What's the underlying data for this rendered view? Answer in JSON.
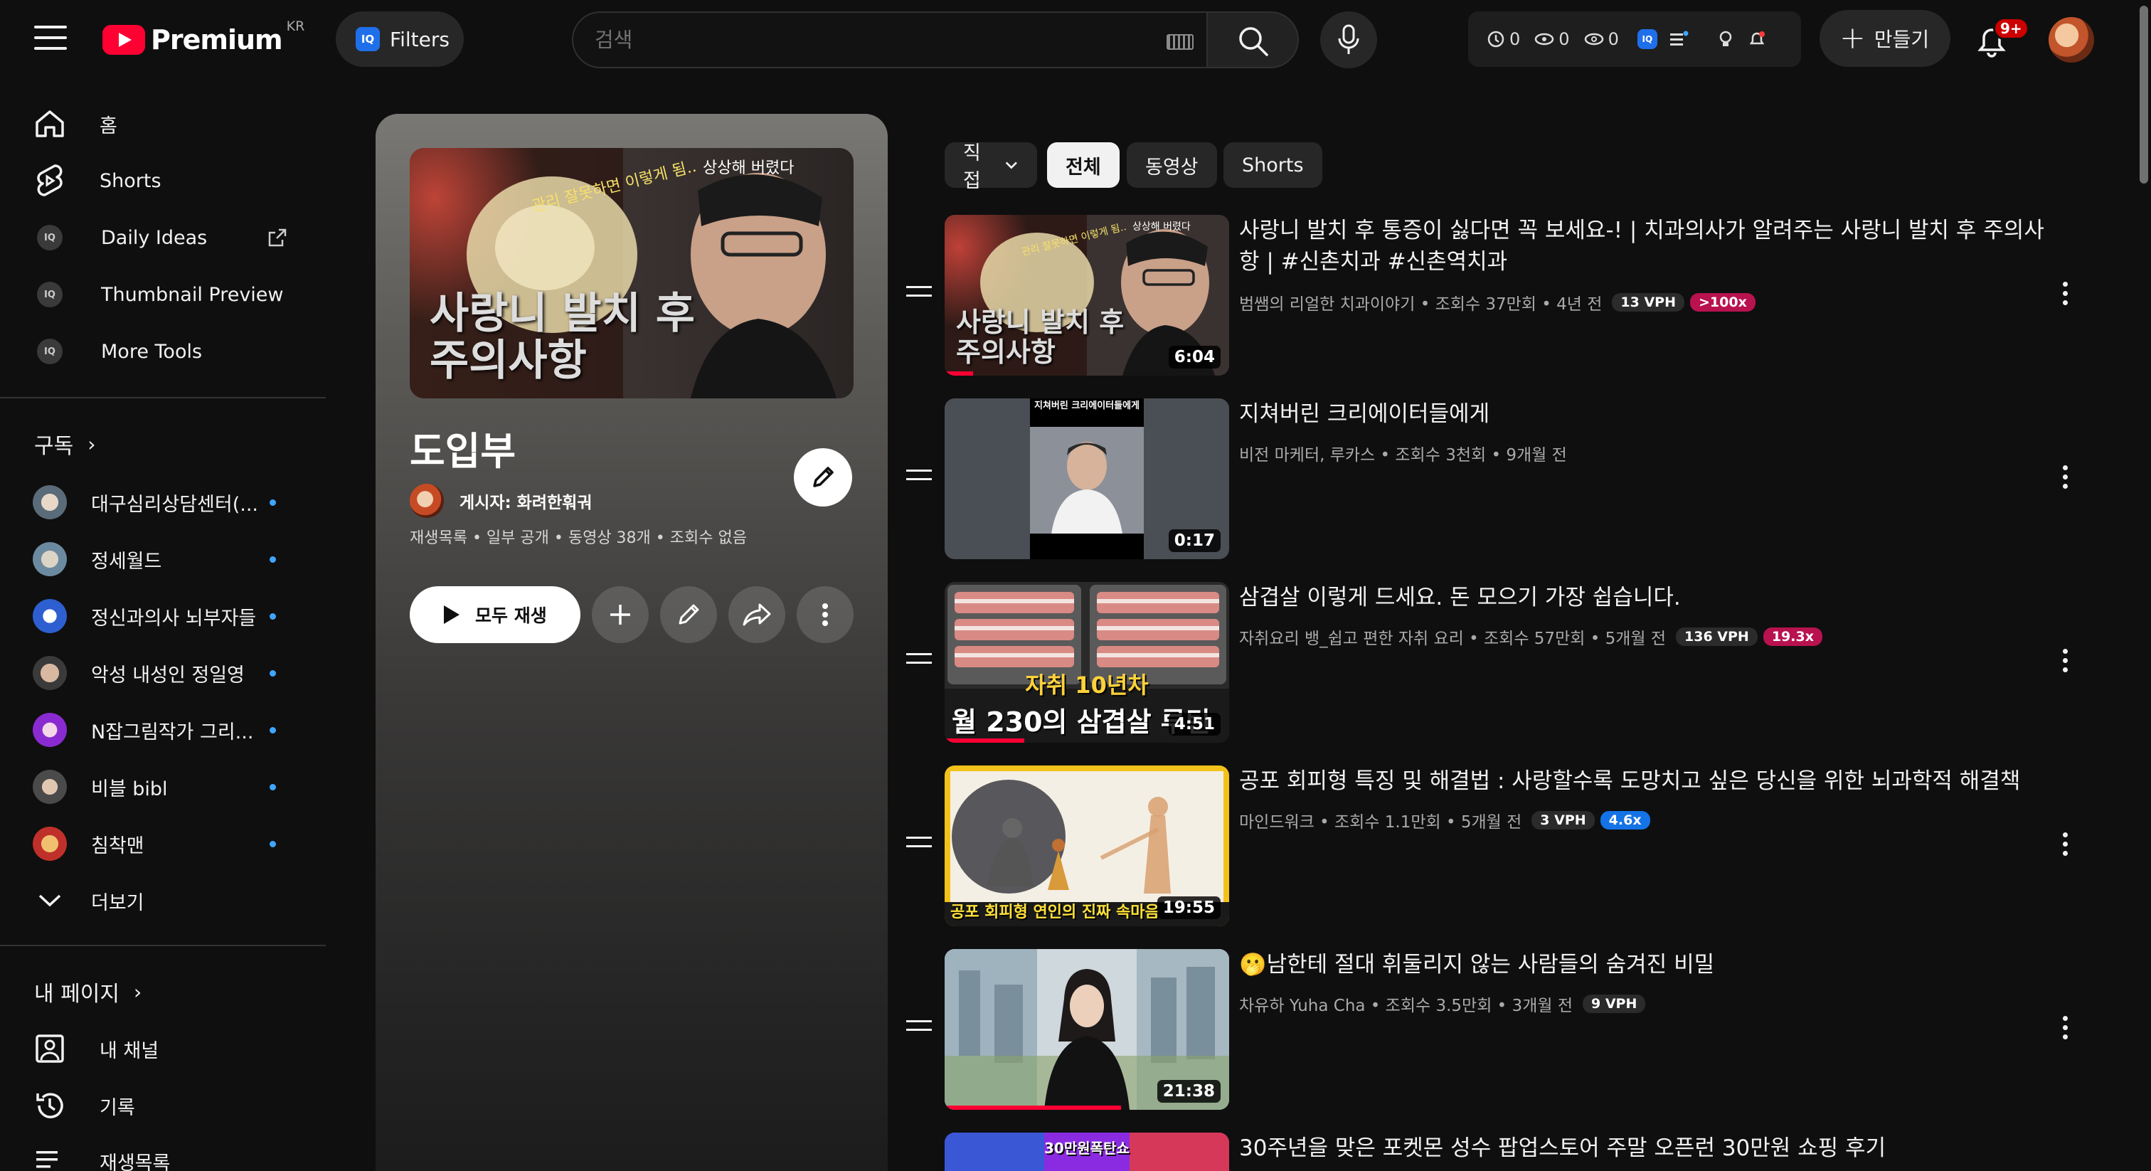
{
  "header": {
    "logo_text": "Premium",
    "logo_region": "KR",
    "filters_label": "Filters",
    "search_placeholder": "검색",
    "ext_stats": [
      "0",
      "0",
      "0"
    ],
    "create_label": "만들기",
    "notification_count": "9+"
  },
  "sidebar": {
    "primary": [
      {
        "label": "홈",
        "icon": "home-icon"
      },
      {
        "label": "Shorts",
        "icon": "shorts-icon"
      },
      {
        "label": "Daily Ideas",
        "icon": "iq-icon"
      },
      {
        "label": "Thumbnail Preview",
        "icon": "iq-icon"
      },
      {
        "label": "More Tools",
        "icon": "iq-icon"
      }
    ],
    "subscriptions_header": "구독",
    "subscriptions": [
      {
        "label": "대구심리상담센터(..."
      },
      {
        "label": "정세월드"
      },
      {
        "label": "정신과의사 뇌부자들"
      },
      {
        "label": "악성 내성인 정일영"
      },
      {
        "label": "N잡그림작가 그리..."
      },
      {
        "label": "비블 bibl"
      },
      {
        "label": "침착맨"
      }
    ],
    "more_label": "더보기",
    "you_header": "내 페이지",
    "you_items": [
      {
        "label": "내 채널",
        "icon": "channel-icon"
      },
      {
        "label": "기록",
        "icon": "history-icon"
      },
      {
        "label": "재생목록",
        "icon": "playlists-icon"
      }
    ]
  },
  "playlist": {
    "title": "도입부",
    "owner": "게시자: 화려한훠궈",
    "meta": "재생목록 • 일부 공개 • 동영상 38개 • 조회수 없음",
    "play_all_label": "모두 재생",
    "thumb_text_line1": "사랑니 발치 후",
    "thumb_text_line2": "주의사항",
    "thumb_handwriting_1": "관리 잘못하면 이렇게 됨..",
    "thumb_handwriting_2": "상상해 버렸다"
  },
  "chips": [
    {
      "label": "직접",
      "has_dropdown": true
    },
    {
      "label": "전체",
      "active": true
    },
    {
      "label": "동영상"
    },
    {
      "label": "Shorts"
    }
  ],
  "videos": [
    {
      "title": "사랑니 발치 후 통증이 싫다면 꼭 보세요-! | 치과의사가 알려주는 사랑니 발치 후 주의사항 | #신촌치과 #신촌역치과",
      "meta": "범쌤의 리얼한 치과이야기 • 조회수 37만회 • 4년 전",
      "vph": "13 VPH",
      "ratio": ">100x",
      "ratio_color": "red",
      "duration": "6:04",
      "progress": 0.1,
      "thumb_line1": "사랑니 발치 후",
      "thumb_line2": "주의사항"
    },
    {
      "title": "지쳐버린 크리에이터들에게",
      "meta": "비전 마케터, 루카스 • 조회수 3천회 • 9개월 전",
      "duration": "0:17",
      "thumb_caption": "지쳐버린 크리에이터들에게"
    },
    {
      "title": "삼겹살 이렇게 드세요. 돈 모으기 가장 쉽습니다.",
      "meta": "자취요리 뱅_쉽고 편한 자취 요리 • 조회수 57만회 • 5개월 전",
      "vph": "136 VPH",
      "ratio": "19.3x",
      "ratio_color": "red",
      "duration": "4:51",
      "progress": 0.28,
      "thumb_line1": "자취 10년차",
      "thumb_line2": "월 230의 삼겹살 루틴"
    },
    {
      "title": "공포 회피형 특징 및 해결법 : 사랑할수록 도망치고 싶은 당신을 위한 뇌과학적 해결책",
      "meta": "마인드워크 • 조회수 1.1만회 • 5개월 전",
      "vph": "3 VPH",
      "ratio": "4.6x",
      "ratio_color": "blue",
      "duration": "19:55",
      "thumb_caption": "공포 회피형 연인의 진짜 속마음"
    },
    {
      "title": "🫢남한테 절대 휘둘리지 않는 사람들의 숨겨진 비밀",
      "meta": "차유하 Yuha Cha • 조회수 3.5만회 • 3개월 전",
      "vph": "9 VPH",
      "duration": "21:38",
      "progress": 0.62
    },
    {
      "title": "30주년을 맞은 포켓몬 성수 팝업스토어 주말 오픈런 30만원 쇼핑 후기",
      "thumb_caption": "30만원폭탄쇼"
    }
  ],
  "colors": {
    "background": "#0f0f0f",
    "accent_red": "#ff0033",
    "pill_red": "#b8124f",
    "pill_blue": "#1473e6",
    "subscription_dot": "#3ea6ff"
  }
}
